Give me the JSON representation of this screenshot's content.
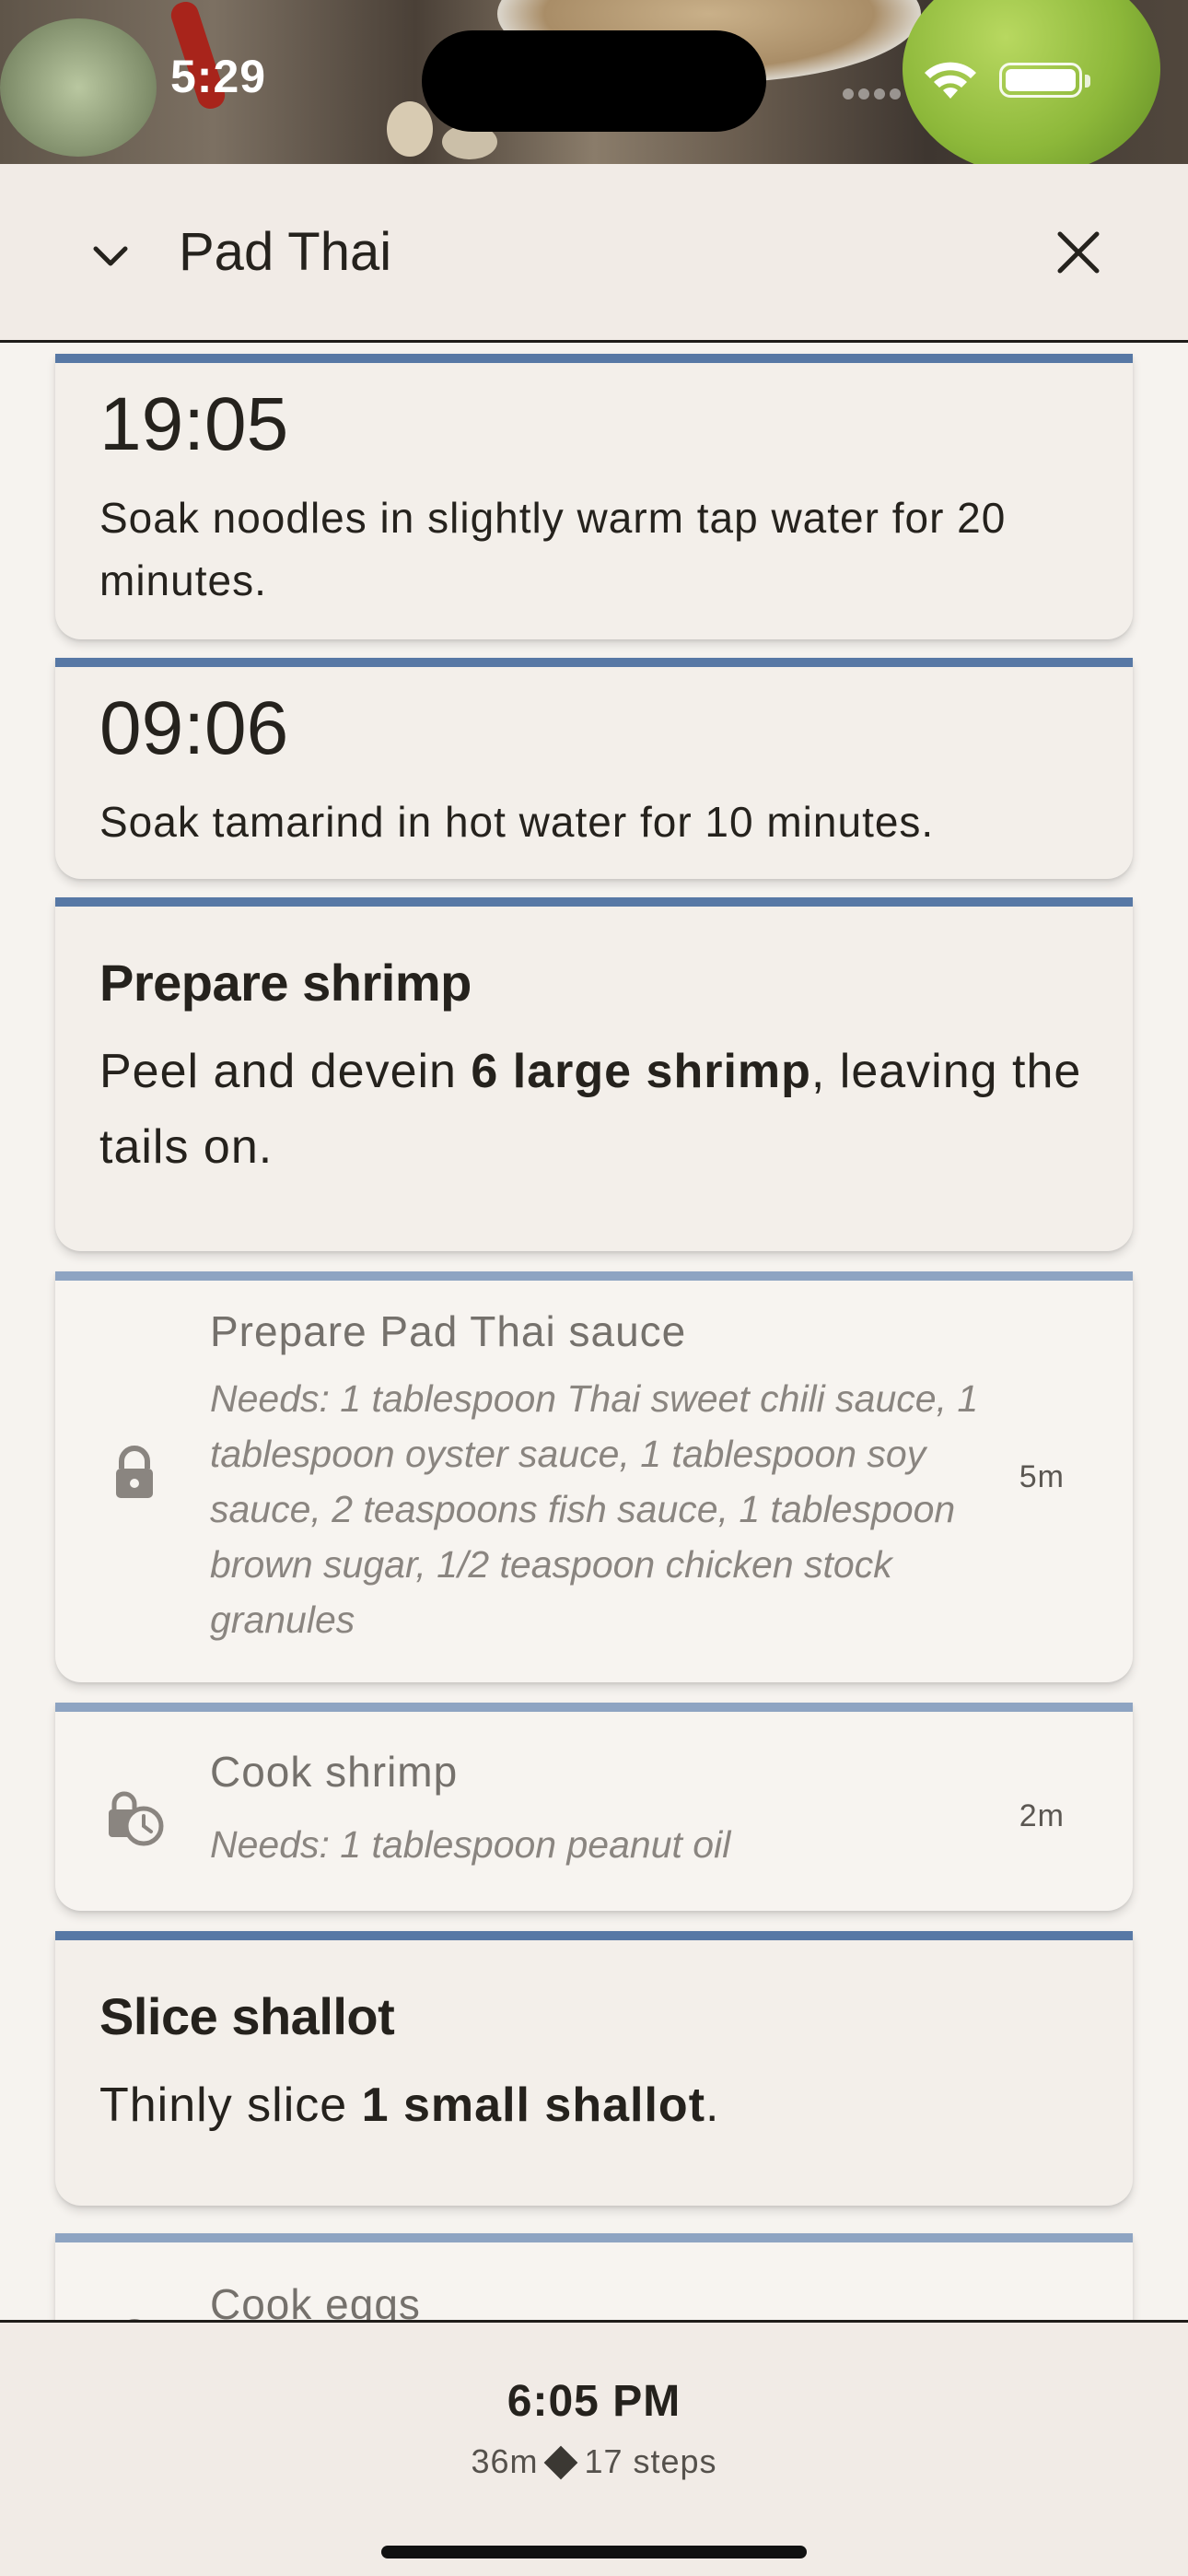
{
  "status_bar": {
    "time": "5:29"
  },
  "header": {
    "title": "Pad Thai"
  },
  "steps": [
    {
      "type": "timer",
      "time": "19:05",
      "text": "Soak noodles in slightly warm tap water for 20 minutes."
    },
    {
      "type": "timer",
      "time": "09:06",
      "text": "Soak tamarind in hot water for 10 minutes."
    },
    {
      "type": "active",
      "title": "Prepare shrimp",
      "body_pre": "Peel and devein ",
      "body_bold": "6 large shrimp",
      "body_post": ", leaving the tails on."
    },
    {
      "type": "locked",
      "icon": "lock-icon",
      "title": "Prepare Pad Thai sauce",
      "needs": "Needs: 1 tablespoon Thai sweet chili sauce, 1 tablespoon oyster sauce, 1 tablespoon soy sauce, 2 teaspoons fish sauce, 1 tablespoon brown sugar, 1/2 teaspoon chicken stock granules",
      "duration": "5m"
    },
    {
      "type": "waiting",
      "icon": "lock-clock-icon",
      "title": "Cook shrimp",
      "needs": "Needs: 1 tablespoon peanut oil",
      "duration": "2m"
    },
    {
      "type": "active",
      "title": "Slice shallot",
      "body_pre": "Thinly slice ",
      "body_bold": "1 small shallot",
      "body_post": "."
    },
    {
      "type": "locked",
      "title": "Cook eggs"
    }
  ],
  "footer": {
    "eta": "6:05 PM",
    "total_time": "36m",
    "step_count": "17 steps"
  },
  "colors": {
    "accent": "#5778a5",
    "accent_dim": "#8ea4c2",
    "background": "#f6f3ef",
    "header_bg": "#f1ebe6"
  }
}
